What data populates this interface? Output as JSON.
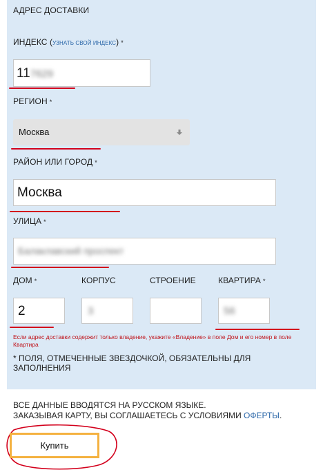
{
  "section_title": "АДРЕС ДОСТАВКИ",
  "postcode": {
    "label_prefix": "ИНДЕКС (",
    "link": "УЗНАТЬ СВОЙ ИНДЕКС",
    "label_suffix": ")",
    "required": "*",
    "value_visible": "11",
    "value_blurred": "7629"
  },
  "region": {
    "label": "РЕГИОН",
    "required": "*",
    "value": "Москва",
    "arrow": "arrow-down-icon"
  },
  "city": {
    "label": "РАЙОН ИЛИ ГОРОД",
    "required": "*",
    "value": "Москва"
  },
  "street": {
    "label": "УЛИЦА",
    "required": "*",
    "value": "Балаклавский проспект"
  },
  "house": {
    "label": "ДОМ",
    "required": "*",
    "value": "2"
  },
  "building": {
    "label": "КОРПУС",
    "value": "3"
  },
  "structure": {
    "label": "СТРОЕНИЕ",
    "value": ""
  },
  "apartment": {
    "label": "КВАРТИРА",
    "required": "*",
    "value": "56"
  },
  "hint": "Если адрес доставки содержит только владение, укажите «Владение» в поле Дом и его номер в поле Квартира",
  "required_note": "* ПОЛЯ, ОТМЕЧЕННЫЕ ЗВЕЗДОЧКОЙ, ОБЯЗАТЕЛЬНЫ ДЛЯ ЗАПОЛНЕНИЯ",
  "footer": {
    "line1": "ВСЕ ДАННЫЕ ВВОДЯТСЯ НА РУССКОМ ЯЗЫКЕ.",
    "line2_prefix": "ЗАКАЗЫВАЯ КАРТУ, ВЫ СОГЛАШАЕТЕСЬ С УСЛОВИЯМИ ",
    "offer_link": "ОФЕРТЫ",
    "line2_suffix": "."
  },
  "buy_button": "Купить",
  "colors": {
    "panel": "#dbe9f6",
    "annotation_red": "#d3001c",
    "button_border": "#f4b140",
    "link": "#2a66a8"
  }
}
